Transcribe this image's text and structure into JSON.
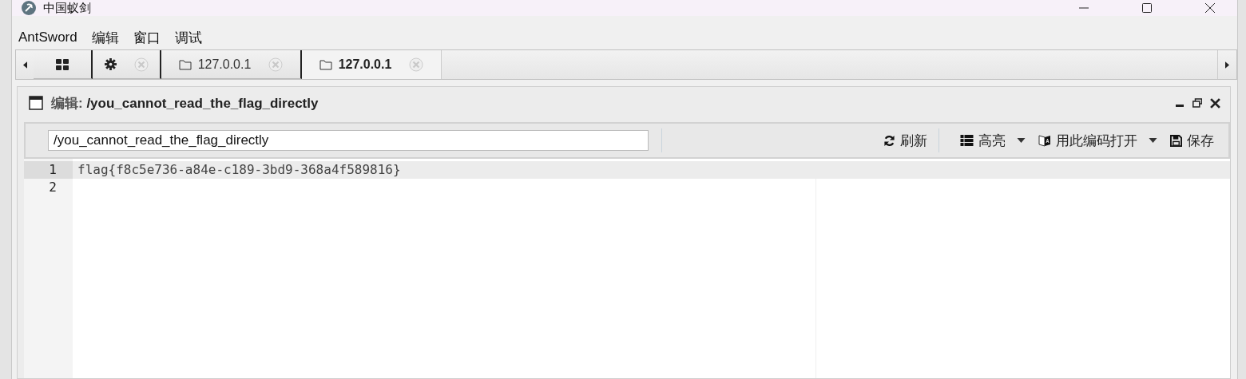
{
  "window": {
    "title": "中国蚁剑"
  },
  "menu": [
    "AntSword",
    "编辑",
    "窗口",
    "调试"
  ],
  "tabs": [
    {
      "kind": "home",
      "selected": false,
      "closable": false
    },
    {
      "kind": "settings",
      "selected": false,
      "closable": true
    },
    {
      "kind": "folder",
      "label": "127.0.0.1",
      "selected": false,
      "closable": true
    },
    {
      "kind": "folder",
      "label": "127.0.0.1",
      "selected": true,
      "closable": true
    }
  ],
  "editor": {
    "title_prefix": "编辑:",
    "title_path": "/you_cannot_read_the_flag_directly",
    "path_field": {
      "value": "/you_cannot_read_the_flag_directly"
    },
    "toolbar": [
      {
        "kind": "refresh",
        "label": "刷新",
        "dropdown": false
      },
      {
        "kind": "highlight",
        "label": "高亮",
        "dropdown": true
      },
      {
        "kind": "encoding",
        "label": "用此编码打开",
        "dropdown": true
      },
      {
        "kind": "save",
        "label": "保存",
        "dropdown": false
      }
    ],
    "lines": [
      {
        "number": "1",
        "text": "flag{f8c5e736-a84e-c189-3bd9-368a4f589816}",
        "current": true
      },
      {
        "number": "2",
        "current": false
      }
    ]
  }
}
